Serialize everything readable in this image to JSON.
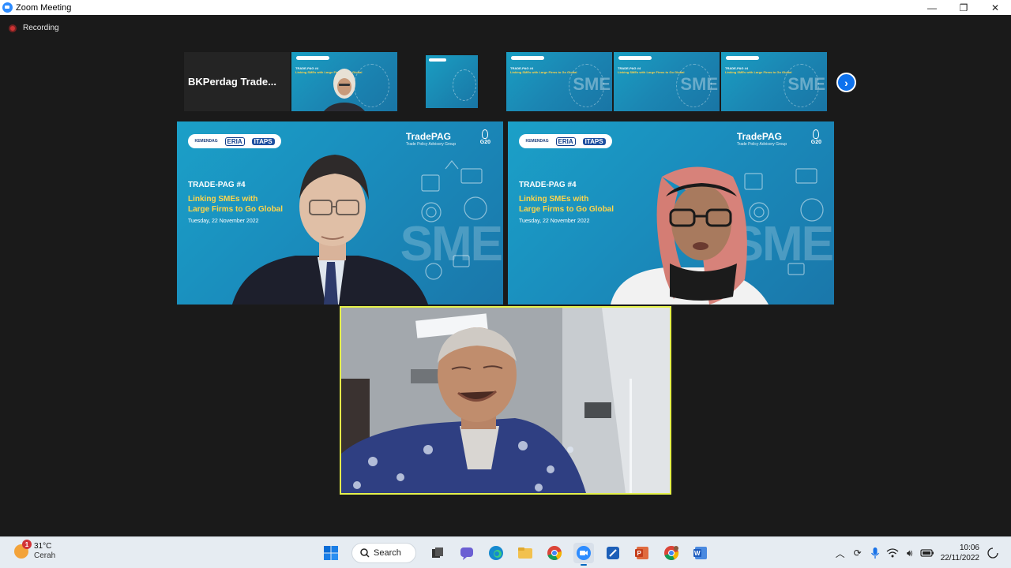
{
  "window": {
    "title": "Zoom Meeting",
    "controls": [
      "minimize",
      "maximize",
      "close"
    ]
  },
  "recording": {
    "label": "Recording"
  },
  "strip": {
    "name_tile": "BKPerdag  Trade...",
    "thumbnails": [
      {
        "kind": "slide-person"
      },
      {
        "kind": "slide-small"
      },
      {
        "kind": "slide"
      },
      {
        "kind": "slide"
      },
      {
        "kind": "slide"
      }
    ],
    "next_icon": "chevron-right-icon"
  },
  "slide": {
    "brand": "TradePAG",
    "brand_sub": "Trade Policy Advisory Group",
    "g20": "G20",
    "logos": [
      "KEMENDAG",
      "ERIA",
      "ITAPS"
    ],
    "series": "TRADE-PAG #4",
    "headline_1": "Linking SMEs with",
    "headline_2": "Large Firms to Go Global",
    "date": "Tuesday, 22 November 2022",
    "watermark": "SME",
    "mini_series": "TRADE-PAG #4",
    "mini_headline": "Linking SMEs with Large Firms to Go Global"
  },
  "taskbar": {
    "weather_temp": "31°C",
    "weather_desc": "Cerah",
    "weather_badge": "1",
    "search_label": "Search",
    "time": "10:06",
    "date": "22/11/2022",
    "apps": [
      "windows-start",
      "search",
      "task-view",
      "teams-chat",
      "edge",
      "file-explorer",
      "chrome",
      "zoom",
      "whiteboard",
      "powerpoint",
      "chrome-profile",
      "word"
    ]
  },
  "colors": {
    "active_speaker_border": "#e5f14a",
    "slide_blue": "#1a8dbd",
    "slide_yellow": "#ffd54a",
    "zoom_blue": "#0e72ed"
  }
}
